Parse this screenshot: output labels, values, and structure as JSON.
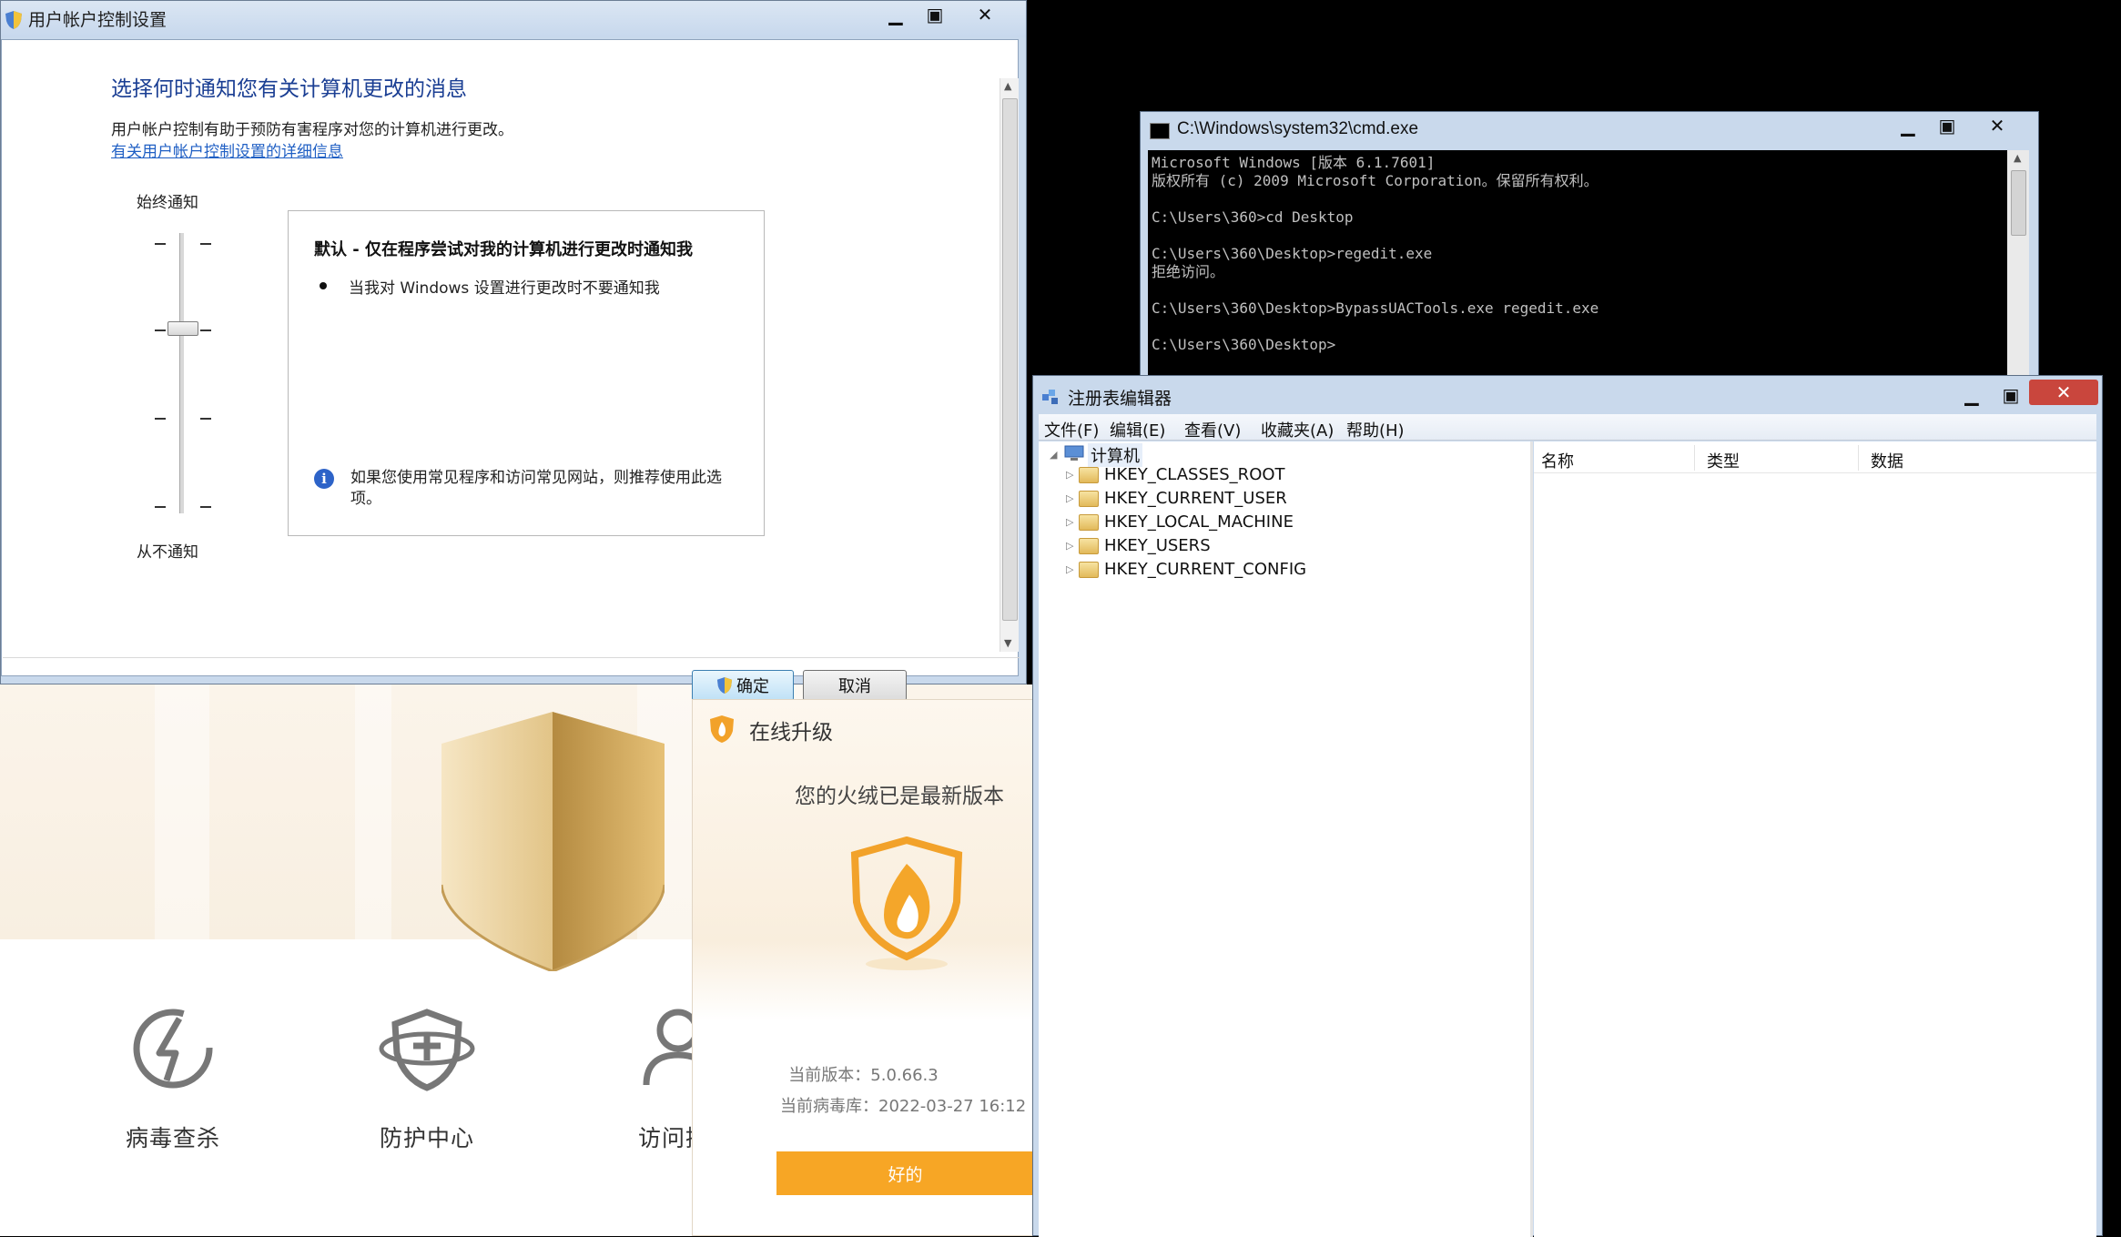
{
  "uac": {
    "title": "用户帐户控制设置",
    "heading": "选择何时通知您有关计算机更改的消息",
    "description": "用户帐户控制有助于预防有害程序对您的计算机进行更改。",
    "link": "有关用户帐户控制设置的详细信息",
    "slider_top": "始终通知",
    "slider_bottom": "从不通知",
    "slider_level": 3,
    "slider_levels": 4,
    "panel_title": "默认 - 仅在程序尝试对我的计算机进行更改时通知我",
    "panel_bullet": "当我对 Windows 设置进行更改时不要通知我",
    "panel_note": "如果您使用常见程序和访问常见网站，则推荐使用此选项。",
    "ok_label": "确定",
    "cancel_label": "取消"
  },
  "cmd": {
    "title": "C:\\Windows\\system32\\cmd.exe",
    "lines": "Microsoft Windows [版本 6.1.7601]\n版权所有 (c) 2009 Microsoft Corporation。保留所有权利。\n\nC:\\Users\\360>cd Desktop\n\nC:\\Users\\360\\Desktop>regedit.exe\n拒绝访问。\n\nC:\\Users\\360\\Desktop>BypassUACTools.exe regedit.exe\n\nC:\\Users\\360\\Desktop>"
  },
  "regedit": {
    "title": "注册表编辑器",
    "menu": [
      "文件(F)",
      "编辑(E)",
      "查看(V)",
      "收藏夹(A)",
      "帮助(H)"
    ],
    "root": "计算机",
    "keys": [
      "HKEY_CLASSES_ROOT",
      "HKEY_CURRENT_USER",
      "HKEY_LOCAL_MACHINE",
      "HKEY_USERS",
      "HKEY_CURRENT_CONFIG"
    ],
    "columns": [
      "名称",
      "类型",
      "数据"
    ]
  },
  "huorong": {
    "features": [
      "病毒查杀",
      "防护中心",
      "访问控"
    ],
    "popup": {
      "title": "在线升级",
      "message": "您的火绒已是最新版本",
      "version": "当前版本：5.0.66.3",
      "virus_db": "当前病毒库：2022-03-27 16:12",
      "ok_label": "好的"
    }
  },
  "colors": {
    "uac_heading": "#1a3e93",
    "link": "#1f5fc4",
    "accent_orange": "#f7a625",
    "shield_gold": "#c9a35c"
  }
}
